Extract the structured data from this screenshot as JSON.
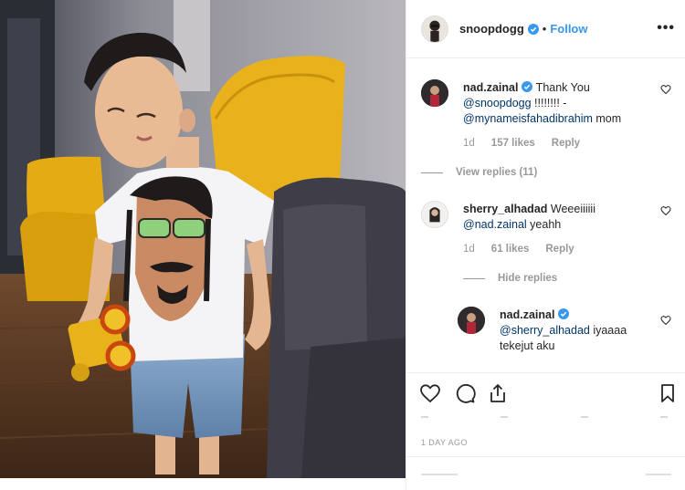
{
  "post": {
    "author": "snoopdogg",
    "follow_label": "Follow",
    "separator": "•",
    "more_label": "•••"
  },
  "comments": [
    {
      "username": "nad.zainal",
      "text_1": " Thank You ",
      "mention_1": "@snoopdogg",
      "text_2": " !!!!!!!! -",
      "mention_2": "@mynameisfahadibrahim",
      "text_3": " mom",
      "age": "1d",
      "likes": "157 likes",
      "reply_label": "Reply",
      "view_replies": "View replies (11)"
    },
    {
      "username": "sherry_alhadad",
      "text_1": " Weeeiiiiii",
      "mention_1": "@nad.zainal",
      "text_2": " yeahh",
      "age": "1d",
      "likes": "61 likes",
      "reply_label": "Reply",
      "hide_replies": "Hide replies"
    },
    {
      "username": "nad.zainal",
      "mention_1": "@sherry_alhadad",
      "text_1": " iyaaaa",
      "text_2": "tekejut aku"
    }
  ],
  "timestamp": "1 DAY AGO",
  "colors": {
    "link_blue": "#3897f0",
    "mention": "#003569",
    "verified": "#3897f0",
    "muted": "#999999"
  },
  "icons": [
    "verified-badge-icon",
    "heart-icon",
    "comment-icon",
    "share-icon",
    "bookmark-icon",
    "more-icon"
  ]
}
